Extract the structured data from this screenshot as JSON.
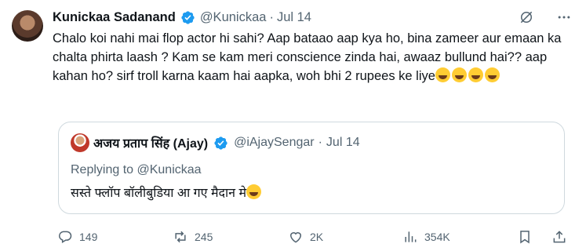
{
  "tweet": {
    "author_name": "Kunickaa Sadanand",
    "handle": "@Kunickaa",
    "separator": "·",
    "date": "Jul 14",
    "text": "Chalo koi nahi mai flop actor hi sahi? Aap bataao aap kya ho, bina zameer aur emaan ka chalta phirta laash ? Kam se kam meri conscience zinda hai, awaaz bullund hai?? aap kahan ho? sirf troll karna kaam hai aapka, woh bhi 2 rupees ke liye",
    "emojis": [
      "joy-emoji",
      "joy-emoji",
      "joy-emoji",
      "joy-emoji"
    ]
  },
  "quoted": {
    "author_name": "अजय प्रताप सिंह (Ajay)",
    "handle": "@iAjaySengar",
    "separator": "·",
    "date": "Jul 14",
    "replying_to": "Replying to @Kunickaa",
    "text": "सस्ते फ्लॉप बॉलीबुडिया आ गए मैदान मे",
    "emoji": "rofl-emoji"
  },
  "actions": {
    "replies": "149",
    "reposts": "245",
    "likes": "2K",
    "views": "354K"
  },
  "colors": {
    "text": "#0f1419",
    "muted": "#536471",
    "verified": "#1d9bf0",
    "border": "#cfd9de"
  }
}
